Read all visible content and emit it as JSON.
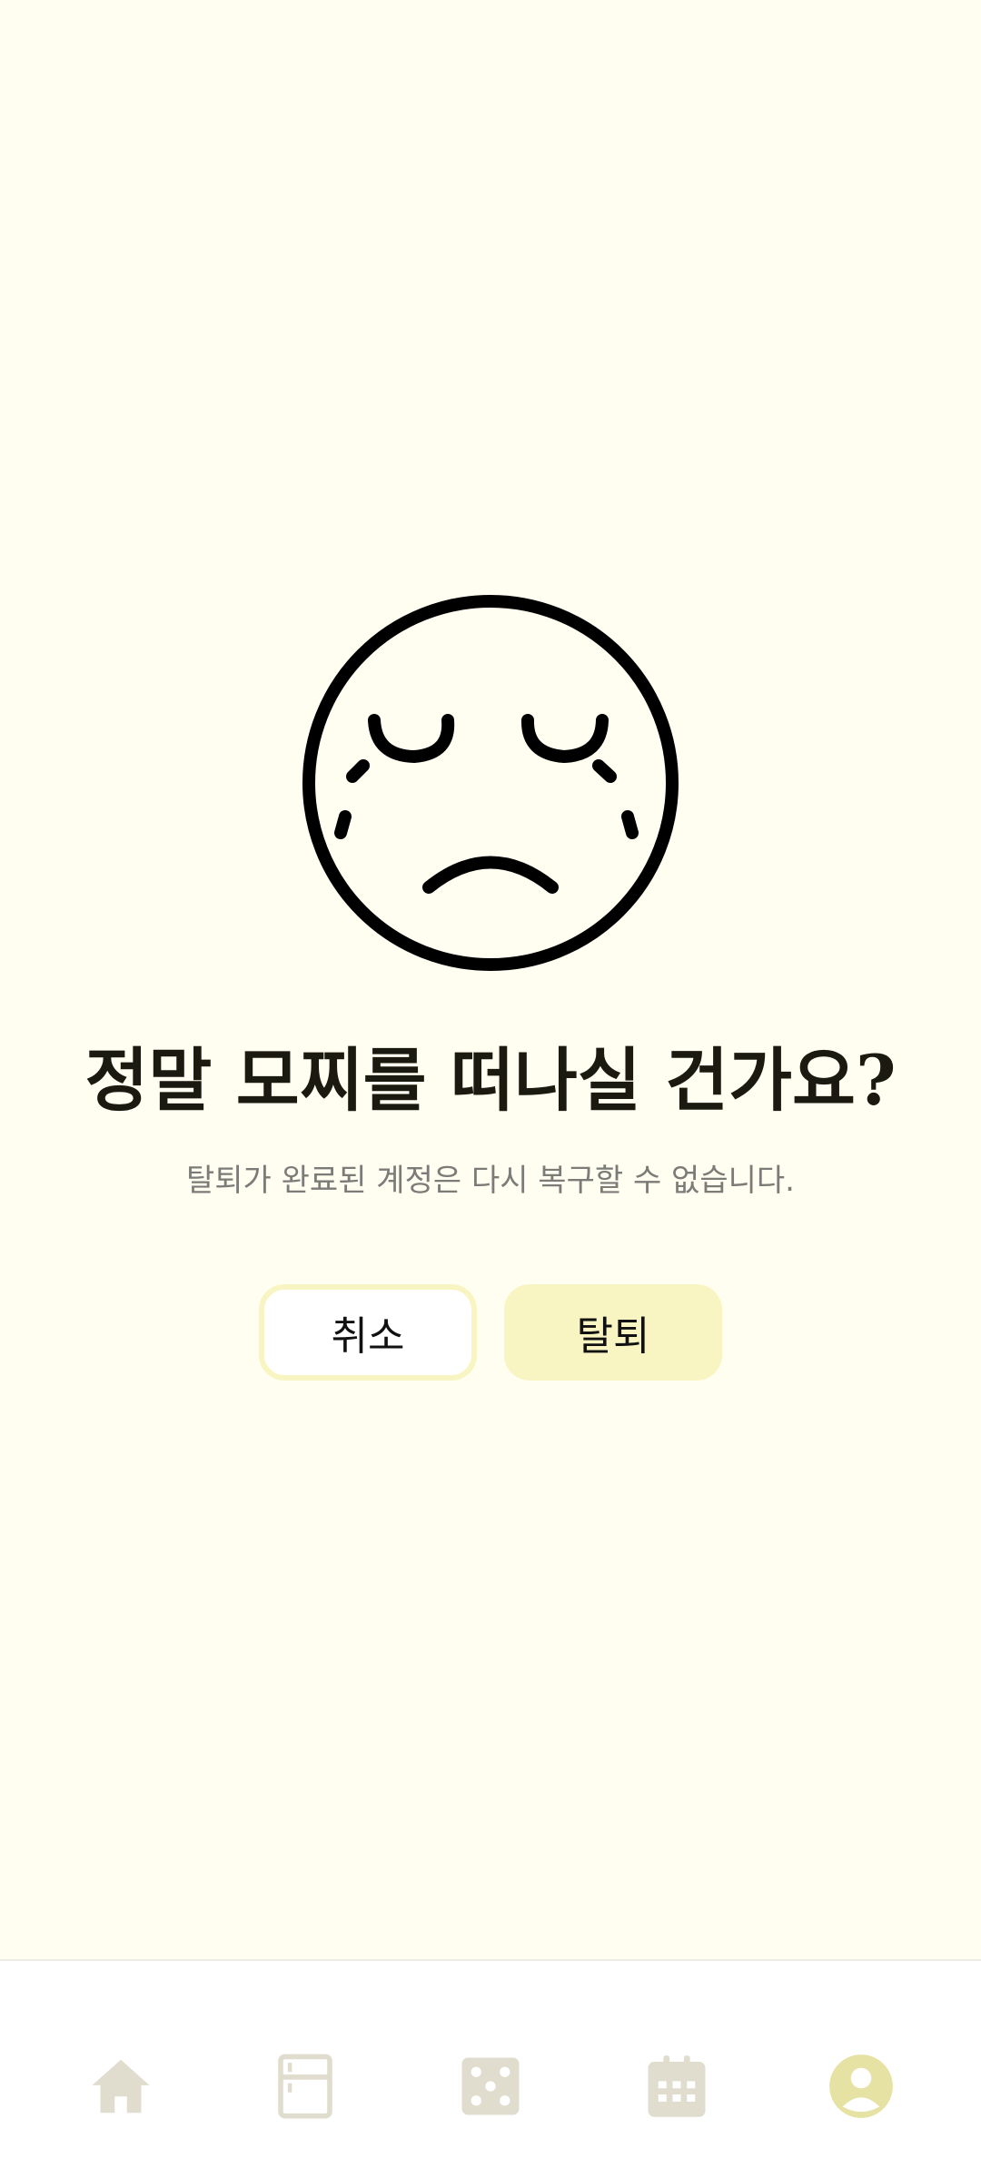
{
  "dialog": {
    "icon": "crying-face-icon",
    "title": "정말 모찌를 떠나실 건가요?",
    "message": "탈퇴가 완료된 계정은 다시 복구할 수 없습니다.",
    "cancel_label": "취소",
    "withdraw_label": "탈퇴"
  },
  "bottom_nav": {
    "items": [
      {
        "icon": "home-icon",
        "active": false
      },
      {
        "icon": "fridge-icon",
        "active": false
      },
      {
        "icon": "dice-icon",
        "active": false
      },
      {
        "icon": "calendar-icon",
        "active": false
      },
      {
        "icon": "profile-icon",
        "active": true
      }
    ]
  },
  "colors": {
    "background": "#FFFEF1",
    "accent": "#F8F5C2",
    "icon_inactive": "#E0DDCE",
    "icon_active": "#E6E2A4",
    "title": "#1B1A10",
    "subtitle": "#7B7B77"
  }
}
